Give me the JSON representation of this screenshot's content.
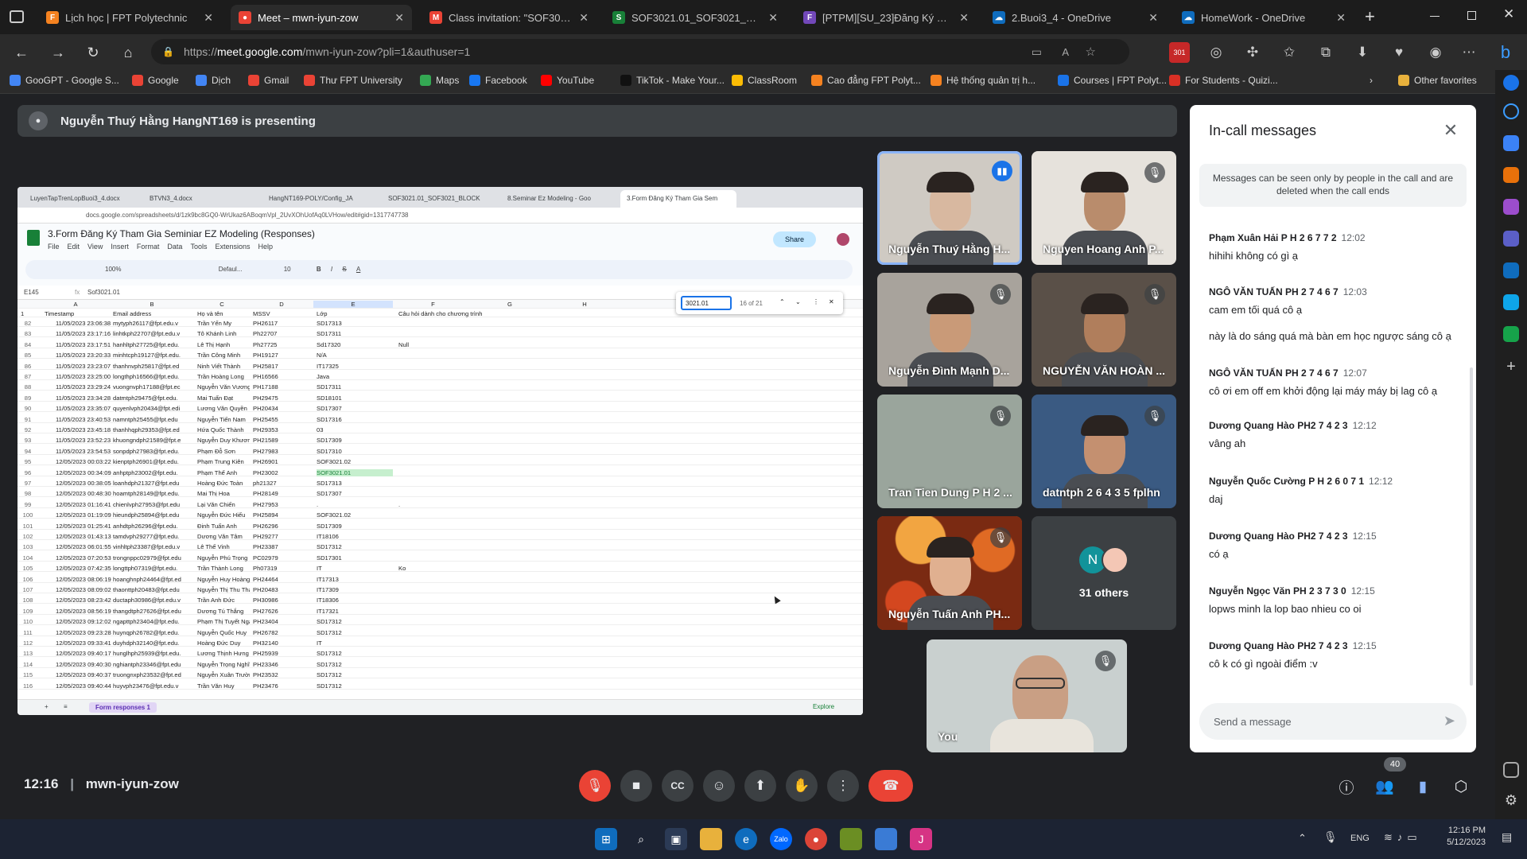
{
  "browser": {
    "tabs": [
      {
        "title": "Lịch học | FPT Polytechnic",
        "color": "#f58220",
        "glyph": "F"
      },
      {
        "title": "Meet – mwn-iyun-zow",
        "color": "#ea4335",
        "glyph": "●"
      },
      {
        "title": "Class invitation: \"SOF3021.01_SO",
        "color": "#ea4335",
        "glyph": "M"
      },
      {
        "title": "SOF3021.01_SOF3021_BLOCK1_",
        "color": "#188038",
        "glyph": "S"
      },
      {
        "title": "[PTPM][SU_23]Đăng Ký Seminar",
        "color": "#7248b9",
        "glyph": "F"
      },
      {
        "title": "2.Buoi3_4 - OneDrive",
        "color": "#0f6cbd",
        "glyph": "☁"
      },
      {
        "title": "HomeWork - OneDrive",
        "color": "#0f6cbd",
        "glyph": "☁"
      }
    ],
    "new_tab": "+",
    "url_prefix": "https://",
    "url_host": "meet.google.com",
    "url_path": "/mwn-iyun-zow?pli=1&authuser=1",
    "badge": "301",
    "bookmarks": [
      {
        "label": "GooGPT - Google S...",
        "color": "#4285f4"
      },
      {
        "label": "Google",
        "color": "#ea4335"
      },
      {
        "label": "Dịch",
        "color": "#4285f4"
      },
      {
        "label": "Gmail",
        "color": "#ea4335"
      },
      {
        "label": "Thư FPT University",
        "color": "#ea4335"
      },
      {
        "label": "Maps",
        "color": "#34a853"
      },
      {
        "label": "Facebook",
        "color": "#1877f2"
      },
      {
        "label": "YouTube",
        "color": "#ff0000"
      },
      {
        "label": "TikTok - Make Your...",
        "color": "#111111"
      },
      {
        "label": "ClassRoom",
        "color": "#fbbc04"
      },
      {
        "label": "Cao đẳng FPT Polyt...",
        "color": "#f58220"
      },
      {
        "label": "Hệ thống quản trị h...",
        "color": "#f58220"
      },
      {
        "label": "Courses | FPT Polyt...",
        "color": "#1a73e8"
      },
      {
        "label": "For Students - Quizi...",
        "color": "#d93025"
      }
    ],
    "other_favorites": "Other favorites"
  },
  "meet": {
    "presenting_banner": "Nguyễn Thuý Hằng HangNT169 is presenting",
    "participants": [
      {
        "name": "Nguyễn Thuý Hằng H...",
        "bg": "#cfcac3",
        "face": "#d8b8a0",
        "speaking": true
      },
      {
        "name": "Nguyen Hoang Anh P...",
        "bg": "#e6e2dc",
        "face": "#b98c6c",
        "speaking": false
      },
      {
        "name": "Nguyễn Đình Mạnh D...",
        "bg": "#a8a39c",
        "face": "#c99a78",
        "speaking": false
      },
      {
        "name": "NGUYỄN VĂN HOÀN ...",
        "bg": "#5a5048",
        "face": "#b07e5c",
        "speaking": false
      },
      {
        "name": "Tran Tien Dung P H 2 ...",
        "bg": "#9aa59c",
        "face": "",
        "speaking": false
      },
      {
        "name": "datntph 2 6 4 3 5 fplhn",
        "bg": "#3a5a82",
        "face": "#c49070",
        "speaking": false
      },
      {
        "name": "Nguyễn Tuấn Anh PH...",
        "bg": "#c8551e",
        "face": "#e0b090",
        "speaking": false
      }
    ],
    "others_count": "31 others",
    "others_avatar_letter": "N",
    "self_label": "You",
    "time": "12:16",
    "meeting_code": "mwn-iyun-zow",
    "people_badge": "40"
  },
  "chat": {
    "title": "In-call messages",
    "notice": "Messages can be seen only by people in the call and are deleted when the call ends",
    "messages": [
      {
        "sender": "Phạm Xuân Hải P H 2 6 7 7 2",
        "time": "12:02",
        "lines": [
          "hihihi không có gì ạ"
        ]
      },
      {
        "sender": "NGÔ VĂN TUẤN PH 2 7 4 6 7",
        "time": "12:03",
        "lines": [
          "cam em tối quá cô ạ",
          "này là do sáng quá mà bàn em học ngược sáng cô ạ"
        ]
      },
      {
        "sender": "NGÔ VĂN TUẤN PH 2 7 4 6 7",
        "time": "12:07",
        "lines": [
          "cô ơi em off em khởi động lại máy máy bị lag cô ạ"
        ]
      },
      {
        "sender": "Dương Quang Hào PH2 7 4 2 3",
        "time": "12:12",
        "lines": [
          "vâng ah"
        ]
      },
      {
        "sender": "Nguyễn Quốc Cường P H 2 6 0 7 1",
        "time": "12:12",
        "lines": [
          "daj"
        ]
      },
      {
        "sender": "Dương Quang Hào PH2 7 4 2 3",
        "time": "12:15",
        "lines": [
          "có ạ"
        ]
      },
      {
        "sender": "Nguyễn Ngọc Văn PH 2 3 7 3 0",
        "time": "12:15",
        "lines": [
          "lopws minh la lop bao nhieu co oi"
        ]
      },
      {
        "sender": "Dương Quang Hào PH2 7 4 2 3",
        "time": "12:15",
        "lines": [
          "cô k có gì ngoài điểm :v"
        ]
      }
    ],
    "input_placeholder": "Send a message"
  },
  "sheet": {
    "tabs": [
      "LuyenTapTrenLopBuoi3_4.docx",
      "BTVN3_4.docx",
      "HangNT169-POLY/Config_JA",
      "SOF3021.01_SOF3021_BLOCK",
      "8.Seminar Ez Modeling - Goo",
      "3.Form Đăng Ký Tham Gia Sem"
    ],
    "url": "docs.google.com/spreadsheets/d/1zk9bc8GQ0-WrUkaz6ABoqmVpl_2UvXOhUofAq0LVHow/edit#gid=1317747738",
    "title": "3.Form Đăng Ký Tham Gia Seminiar EZ Modeling (Responses)",
    "menu": [
      "File",
      "Edit",
      "View",
      "Insert",
      "Format",
      "Data",
      "Tools",
      "Extensions",
      "Help"
    ],
    "share": "Share",
    "toolbar_zoom": "100%",
    "toolbar_font": "Defaul...",
    "toolbar_size": "10",
    "cell_ref": "E145",
    "formula": "Sof3021.01",
    "find_text": "3021.01",
    "find_count": "16 of 21",
    "col_letters": [
      "A",
      "B",
      "C",
      "D",
      "E",
      "F",
      "G",
      "H"
    ],
    "headers": [
      "Timestamp",
      "Email address",
      "Họ và tên",
      "MSSV",
      "Lớp",
      "Câu hỏi dành cho chương trình"
    ],
    "rows": [
      [
        "82",
        "11/05/2023 23:06:38",
        "mytyph26117@fpt.edu.v",
        "Trần Yến My",
        "PH26117",
        "SD17313",
        ""
      ],
      [
        "83",
        "11/05/2023 23:17:16",
        "linhtkph22707@fpt.edu.v",
        "Tô Khánh Linh",
        "Ph22707",
        "SD17311",
        ""
      ],
      [
        "84",
        "11/05/2023 23:17:51",
        "hanhltph27725@fpt.edu.",
        "Lê Thị Hạnh",
        "Ph27725",
        "Sd17320",
        "Null"
      ],
      [
        "85",
        "11/05/2023 23:20:33",
        "minhtcph19127@fpt.edu.",
        "Trần Công Minh",
        "PH19127",
        "N/A",
        ""
      ],
      [
        "86",
        "11/05/2023 23:23:07",
        "thanhnvph25817@fpt.ed",
        "Ninh Viết Thành",
        "PH25817",
        "IT17325",
        ""
      ],
      [
        "87",
        "11/05/2023 23:25:00",
        "longthph16566@fpt.edu.",
        "Trần Hoàng Long",
        "PH16566",
        "Java",
        ""
      ],
      [
        "88",
        "11/05/2023 23:29:24",
        "vuongnvph17188@fpt.ec",
        "Nguyễn Văn Vương",
        "PH17188",
        "SD17311",
        ""
      ],
      [
        "89",
        "11/05/2023 23:34:28",
        "datmtph29475@fpt.edu.",
        "Mai Tuấn Đạt",
        "PH29475",
        "SD18101",
        ""
      ],
      [
        "90",
        "11/05/2023 23:35:07",
        "quyenlvph20434@fpt.edi",
        "Lương Văn Quyền",
        "PH20434",
        "SD17307",
        ""
      ],
      [
        "91",
        "11/05/2023 23:40:53",
        "namntph25455@fpt.edu",
        "Nguyễn Tiến Nam",
        "PH25455",
        "SD17316",
        ""
      ],
      [
        "92",
        "11/05/2023 23:45:18",
        "thanhhqph29353@fpt.ed",
        "Hứa Quốc Thành",
        "PH29353",
        "03",
        ""
      ],
      [
        "93",
        "11/05/2023 23:52:23",
        "khuongndph21589@fpt.e",
        "Nguyễn Duy Khương",
        "PH21589",
        "SD17309",
        ""
      ],
      [
        "94",
        "11/05/2023 23:54:53",
        "sonpdph27983@fpt.edu.",
        "Phạm Đỗ Sơn",
        "PH27983",
        "SD17310",
        ""
      ],
      [
        "95",
        "12/05/2023 00:03:22",
        "kienptph26901@fpt.edu.",
        "Phạm Trung Kiên",
        "PH26901",
        "SOF3021.02",
        ""
      ],
      [
        "96",
        "12/05/2023 00:34:09",
        "anhptph23002@fpt.edu.",
        "Phạm Thế Anh",
        "PH23002",
        "SOF3021.01",
        ""
      ],
      [
        "97",
        "12/05/2023 00:38:05",
        "loanhdph21327@fpt.edu",
        "Hoàng Đức Toàn",
        "ph21327",
        "SD17313",
        ""
      ],
      [
        "98",
        "12/05/2023 00:48:30",
        "hoamtph28149@fpt.edu.",
        "Mai Thị Hoa",
        "PH28149",
        "SD17307",
        ""
      ],
      [
        "99",
        "12/05/2023 01:16:41",
        "chienlvph27953@fpt.edu",
        "Lại Văn Chiến",
        "PH27953",
        ".",
        "."
      ],
      [
        "100",
        "12/05/2023 01:19:09",
        "hieundph25894@fpt.edu",
        "Nguyễn Đức Hiếu",
        "PH25894",
        "SOF3021.02",
        ""
      ],
      [
        "101",
        "12/05/2023 01:25:41",
        "anhdtph26296@fpt.edu.",
        "Đinh Tuấn Anh",
        "PH26296",
        "SD17309",
        ""
      ],
      [
        "102",
        "12/05/2023 01:43:13",
        "tamdvph29277@fpt.edu.",
        "Dương Văn Tâm",
        "PH29277",
        "IT18106",
        ""
      ],
      [
        "103",
        "12/05/2023 06:01:55",
        "vinhltph23387@fpt.edu.v",
        "Lê Thế Vinh",
        "PH23387",
        "SD17312",
        ""
      ],
      [
        "104",
        "12/05/2023 07:20:53",
        "trongnppc02979@fpt.edu",
        "Nguyễn Phú Trọng",
        "PC02979",
        "SD17301",
        ""
      ],
      [
        "105",
        "12/05/2023 07:42:35",
        "longttph07319@fpt.edu.",
        "Trần Thành Long",
        "Ph07319",
        "IT",
        "Ko"
      ],
      [
        "106",
        "12/05/2023 08:06:19",
        "hoanghnph24464@fpt.ed",
        "Nguyễn Huy Hoàng",
        "PH24464",
        "IT17313",
        ""
      ],
      [
        "107",
        "12/05/2023 08:09:02",
        "thaonttph20483@fpt.edu",
        "Nguyễn Thị Thu Thảo",
        "PH20483",
        "IT17309",
        ""
      ],
      [
        "108",
        "12/05/2023 08:23:42",
        "ductaph30986@fpt.edu.v",
        "Trần Anh Đức",
        "PH30986",
        "IT18306",
        ""
      ],
      [
        "109",
        "12/05/2023 08:56:19",
        "thangdtph27626@fpt.edu",
        "Dương Tú Thắng",
        "PH27626",
        "IT17321",
        ""
      ],
      [
        "110",
        "12/05/2023 09:12:02",
        "ngapttph23404@fpt.edu.",
        "Phạm Thị Tuyết Nga",
        "PH23404",
        "SD17312",
        ""
      ],
      [
        "111",
        "12/05/2023 09:23:28",
        "huynqph26782@fpt.edu.",
        "Nguyễn Quốc Huy",
        "PH26782",
        "SD17312",
        ""
      ],
      [
        "112",
        "12/05/2023 09:33:41",
        "duyhdph32140@fpt.edu.",
        "Hoàng Đức Duy",
        "PH32140",
        "IT",
        ""
      ],
      [
        "113",
        "12/05/2023 09:40:17",
        "hunglhph25939@fpt.edu.",
        "Lương Thịnh Hưng",
        "PH25939",
        "SD17312",
        ""
      ],
      [
        "114",
        "12/05/2023 09:40:30",
        "nghiantph23346@fpt.edu",
        "Nguyễn Trọng Nghĩa",
        "PH23346",
        "SD17312",
        ""
      ],
      [
        "115",
        "12/05/2023 09:40:37",
        "truongnxph23532@fpt.ed",
        "Nguyễn Xuân Trường",
        "PH23532",
        "SD17312",
        ""
      ],
      [
        "116",
        "12/05/2023 09:40:44",
        "huyvph23476@fpt.edu.v",
        "Trần Văn Huy",
        "PH23476",
        "SD17312",
        ""
      ]
    ],
    "sheet_tab": "Form responses 1",
    "explore": "Explore"
  },
  "taskbar": {
    "lang": "ENG",
    "time": "12:16 PM",
    "date": "5/12/2023"
  }
}
